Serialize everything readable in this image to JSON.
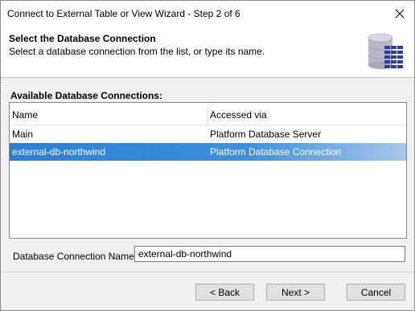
{
  "window": {
    "title": "Connect to External Table or View Wizard - Step 2 of 6",
    "close_icon": "close-icon"
  },
  "header": {
    "title": "Select the Database Connection",
    "subtitle": "Select a database connection from the list, or type its name.",
    "icon": "database-icon"
  },
  "connections": {
    "label": "Available Database Connections:",
    "columns": [
      "Name",
      "Accessed via"
    ],
    "rows": [
      {
        "name": "Main",
        "accessed_via": "Platform Database Server",
        "selected": false
      },
      {
        "name": "external-db-northwind",
        "accessed_via": "Platform Database Connection",
        "selected": true
      }
    ]
  },
  "connection_name": {
    "label": "Database Connection Name:",
    "value": "external-db-northwind"
  },
  "buttons": {
    "back": "< Back",
    "next": "Next >",
    "cancel": "Cancel"
  },
  "colors": {
    "selection": "#2a7fd4",
    "icon": "#2e3d9e"
  }
}
